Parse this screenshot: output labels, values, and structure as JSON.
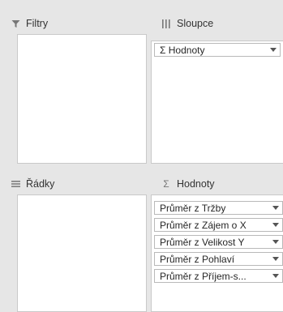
{
  "filters": {
    "title": "Filtry",
    "icon": "filter-icon"
  },
  "columns": {
    "title": "Sloupce",
    "icon": "columns-icon",
    "fields": [
      {
        "label": "Σ  Hodnoty"
      }
    ]
  },
  "rows": {
    "title": "Řádky",
    "icon": "rows-icon"
  },
  "values": {
    "title": "Hodnoty",
    "icon": "sigma-icon",
    "fields": [
      {
        "label": "Průměr z Tržby"
      },
      {
        "label": "Průměr z Zájem o X"
      },
      {
        "label": "Průměr z Velikost Y"
      },
      {
        "label": "Průměr z Pohlaví"
      },
      {
        "label": "Průměr z Příjem-s..."
      }
    ]
  }
}
